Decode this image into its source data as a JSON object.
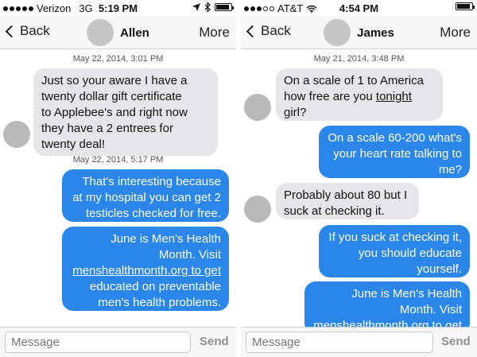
{
  "left": {
    "status": {
      "carrier": "Verizon",
      "network": "3G",
      "time": "5:19 PM"
    },
    "nav": {
      "back_label": "Back",
      "contact_name": "Allen",
      "more_label": "More"
    },
    "messages": [
      {
        "stamp": "May 22, 2014, 3:01 PM"
      },
      {
        "dir": "in",
        "lines": [
          "Just so your aware I have a",
          "twenty dollar gift certificate",
          "to Applebee's and right now",
          "they have a 2 entrees for",
          "twenty deal!"
        ]
      },
      {
        "stamp": "May 22, 2014, 5:17 PM"
      },
      {
        "dir": "out",
        "lines": [
          "That's interesting because",
          "at my hospital you can get 2",
          "testicles checked for free."
        ]
      },
      {
        "dir": "out",
        "lines": [
          "June is Men's Health",
          "Month. Visit",
          "menshealthmonth.org to get",
          "educated on preventable",
          "men's health problems."
        ]
      }
    ],
    "composer": {
      "placeholder": "Message",
      "send_label": "Send"
    }
  },
  "right": {
    "status": {
      "carrier": "AT&T",
      "time": "4:54 PM"
    },
    "nav": {
      "back_label": "Back",
      "contact_name": "James",
      "more_label": "More"
    },
    "messages": [
      {
        "stamp": "May 21, 2014, 3:48 PM"
      },
      {
        "dir": "in",
        "lines": [
          "On a scale of 1 to America",
          "how free are you tonight",
          "girl?"
        ]
      },
      {
        "dir": "out",
        "lines": [
          "On a scale 60-200 what's",
          "your heart rate talking to",
          "me?"
        ]
      },
      {
        "dir": "in",
        "lines": [
          "Probably about 80 but I",
          "suck at checking it."
        ]
      },
      {
        "dir": "out",
        "lines": [
          "If you suck at checking it,",
          "you should educate",
          "yourself."
        ]
      },
      {
        "dir": "out",
        "lines": [
          "June is Men's Health",
          "Month. Visit",
          "menshealthmonth.org to get"
        ]
      }
    ],
    "composer": {
      "placeholder": "Message",
      "send_label": "Send"
    }
  },
  "colors": {
    "outgoing_bubble": "#2b86ea",
    "incoming_bubble": "#e5e5ea"
  }
}
